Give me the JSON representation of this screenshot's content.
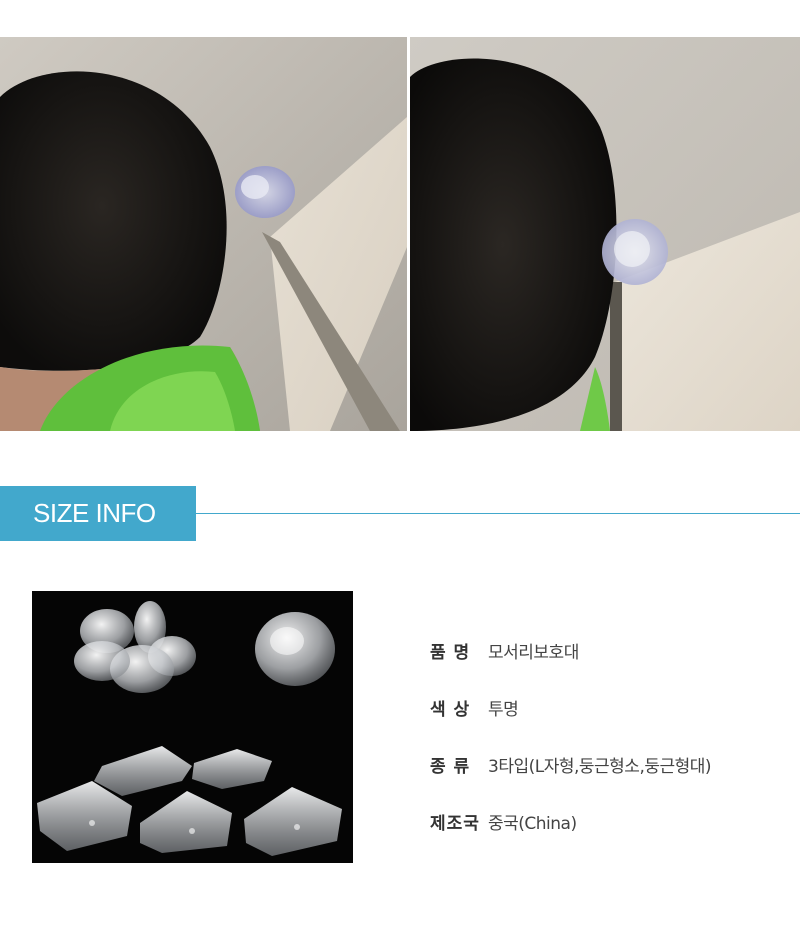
{
  "photos": {
    "left_alt": "child head near table corner with round guard",
    "right_alt": "close-up of child head near table corner with clear guard"
  },
  "size_info": {
    "title": "SIZE INFO"
  },
  "specs": [
    {
      "label": "품 명",
      "value": "모서리보호대"
    },
    {
      "label": "색 상",
      "value": "투명"
    },
    {
      "label": "종 류",
      "value": "3타입(L자형,둥근형소,둥근형대)"
    },
    {
      "label": "제조국",
      "value": "중국(China)"
    }
  ],
  "colors": {
    "accent": "#42a8cc",
    "product_background": "#050505"
  }
}
